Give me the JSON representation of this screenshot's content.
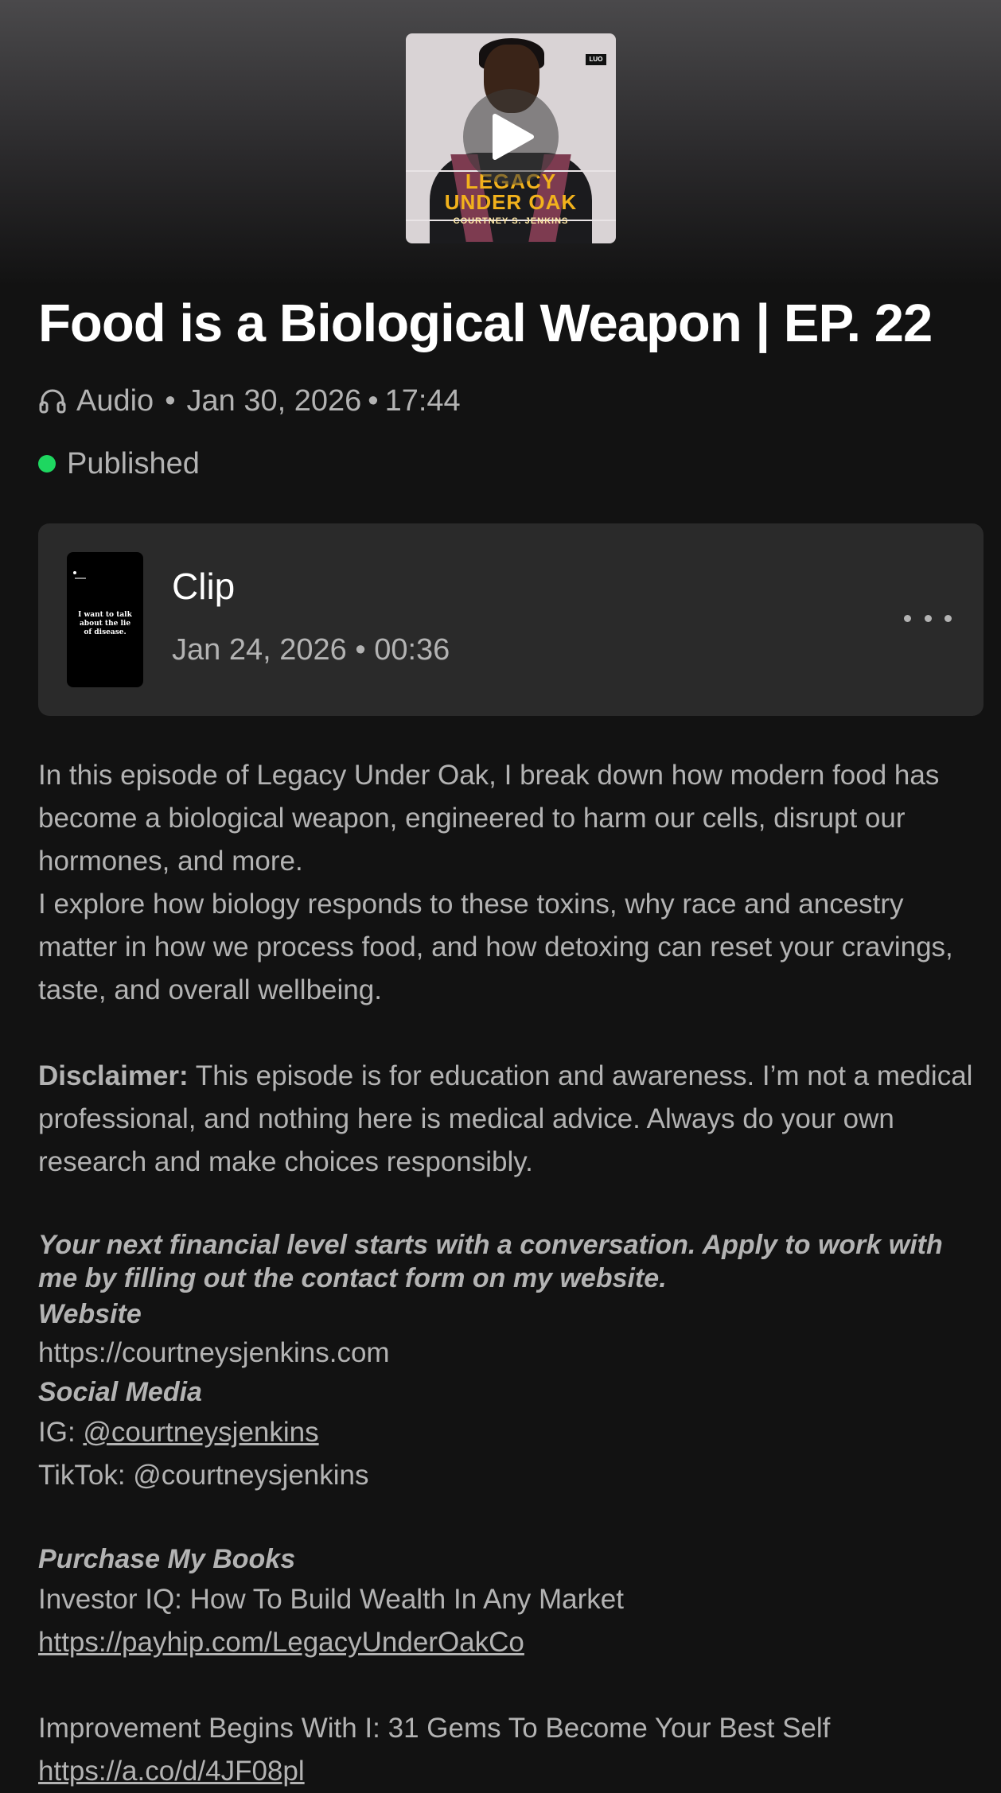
{
  "cover": {
    "title_line1": "LEGACY",
    "title_line2": "UNDER OAK",
    "author": "COURTNEY S. JENKINS",
    "logo": "LUO"
  },
  "episode": {
    "title": "Food is a Biological Weapon | EP. 22",
    "type": "Audio",
    "date": "Jan 30, 2026",
    "duration": "17:44",
    "status": "Published",
    "status_color": "#1ed760"
  },
  "clip": {
    "label": "Clip",
    "date": "Jan 24, 2026",
    "duration": "00:36",
    "thumb_text": "I want to talk about the lie of disease."
  },
  "description": {
    "para1_line1": "In this episode of Legacy Under Oak, I break down how modern food has become a biological weapon, engineered to harm our cells, disrupt our hormones, and more.",
    "para1_line2": "I explore how biology responds to these toxins, why race and ancestry matter in how we process food, and how detoxing can reset your cravings, taste, and overall wellbeing.",
    "disclaimer_label": "Disclaimer:",
    "disclaimer_text": " This episode is for education and awareness. I’m not a medical professional, and nothing here is medical advice. Always do your own research and make choices responsibly.",
    "cta": "Your next financial level starts with a conversation. Apply to work with me by filling out the contact form on my website.",
    "website_label": "Website",
    "website_url": "https://courtneysjenkins.com",
    "social_label": "Social Media",
    "ig_prefix": "IG: ",
    "ig_handle": "@courtneysjenkins",
    "tiktok": "TikTok: @courtneysjenkins",
    "books_label": "Purchase My Books",
    "book1_title": "Investor IQ: How To Build Wealth In Any Market",
    "book1_url": "https://payhip.com/LegacyUnderOakCo",
    "book2_title": "Improvement Begins With I: 31 Gems To Become Your Best Self",
    "book2_url": "https://a.co/d/4JF08pl"
  }
}
